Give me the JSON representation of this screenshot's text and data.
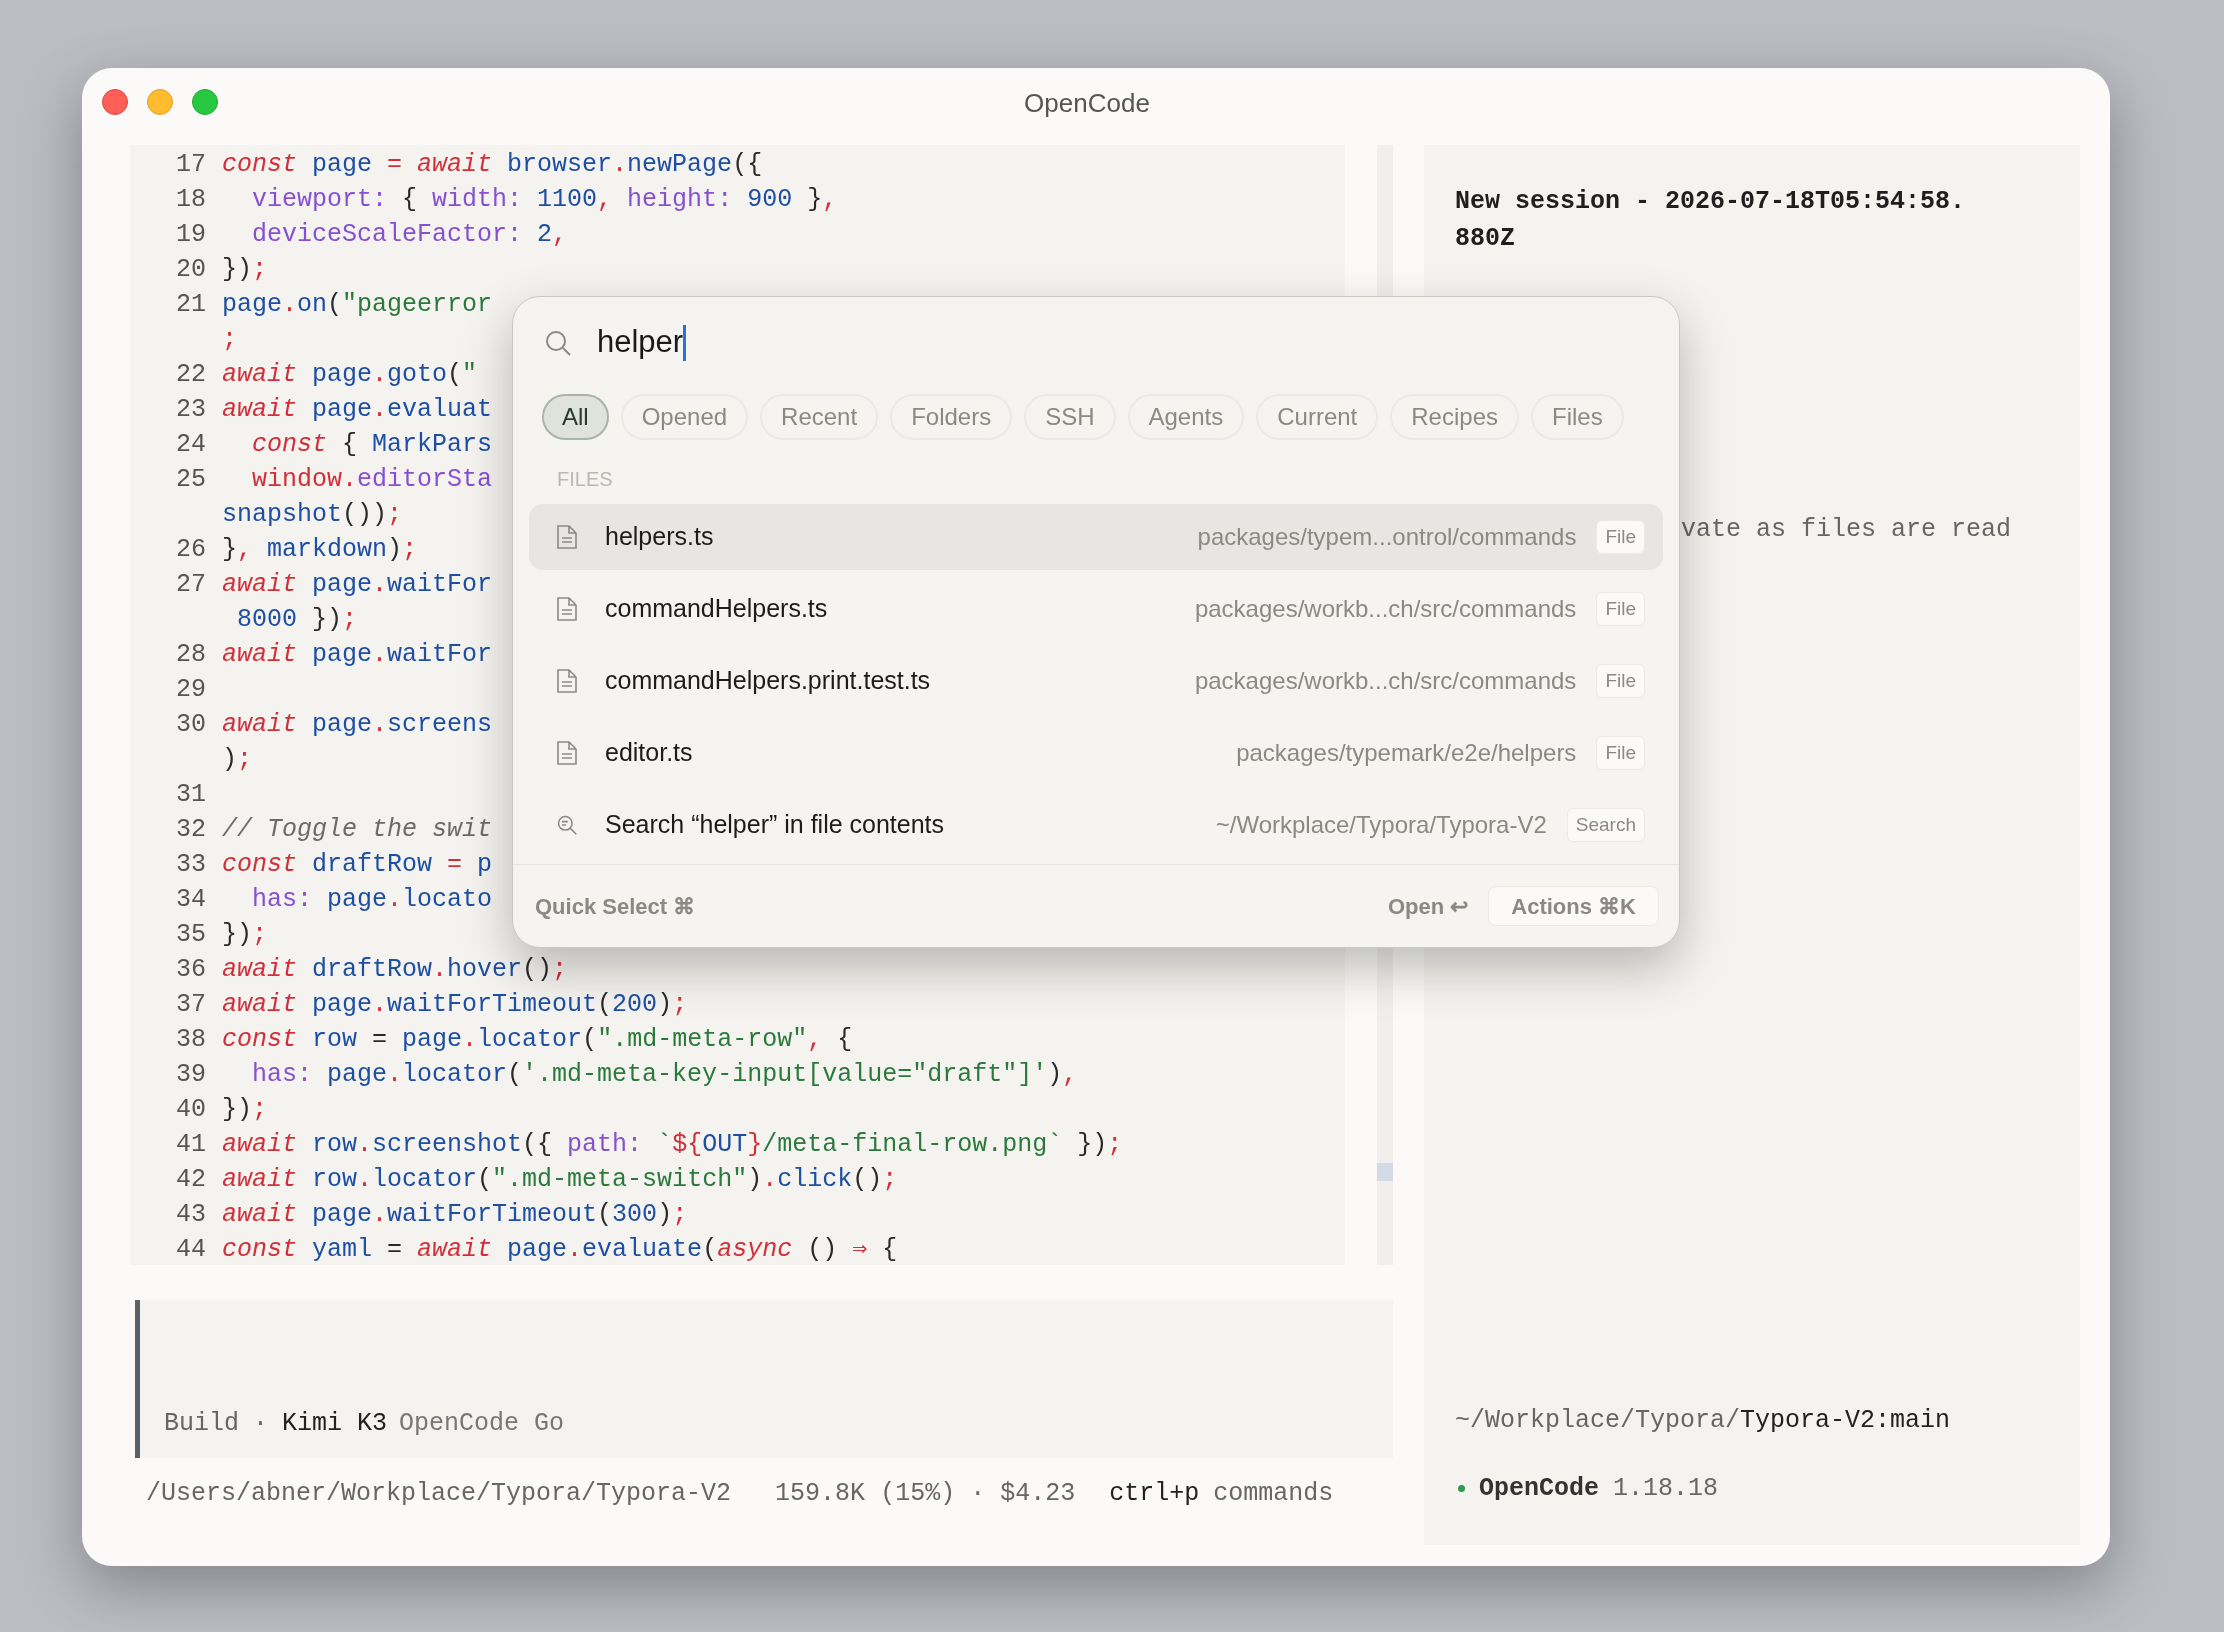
{
  "window": {
    "title": "OpenCode"
  },
  "editor": {
    "lines": [
      {
        "num": "17",
        "tokens": [
          {
            "kind": "kw",
            "text": "const"
          },
          {
            "kind": "id",
            "text": " page"
          },
          {
            "kind": "pu",
            "text": " ="
          },
          {
            "kind": "kw",
            "text": " await"
          },
          {
            "kind": "id",
            "text": " browser"
          },
          {
            "kind": "pu",
            "text": "."
          },
          {
            "kind": "id",
            "text": "newPage"
          },
          {
            "kind": "pl",
            "text": "({"
          }
        ]
      },
      {
        "num": "18",
        "tokens": [
          {
            "kind": "pr",
            "text": "  viewport:"
          },
          {
            "kind": "pl",
            "text": " {"
          },
          {
            "kind": "pr",
            "text": " width:"
          },
          {
            "kind": "nu",
            "text": " 1100"
          },
          {
            "kind": "pu",
            "text": ","
          },
          {
            "kind": "pr",
            "text": " height:"
          },
          {
            "kind": "nu",
            "text": " 900"
          },
          {
            "kind": "pl",
            "text": " }"
          },
          {
            "kind": "pu",
            "text": ","
          }
        ]
      },
      {
        "num": "19",
        "tokens": [
          {
            "kind": "pr",
            "text": "  deviceScaleFactor:"
          },
          {
            "kind": "nu",
            "text": " 2"
          },
          {
            "kind": "pu",
            "text": ","
          }
        ]
      },
      {
        "num": "20",
        "tokens": [
          {
            "kind": "pl",
            "text": "})"
          },
          {
            "kind": "pu",
            "text": ";"
          }
        ]
      },
      {
        "num": "21",
        "tokens": [
          {
            "kind": "id",
            "text": "page"
          },
          {
            "kind": "pu",
            "text": "."
          },
          {
            "kind": "id",
            "text": "on"
          },
          {
            "kind": "pl",
            "text": "("
          },
          {
            "kind": "st",
            "text": "\"pageerror"
          }
        ],
        "continuation": [
          {
            "kind": "pu",
            "text": ";"
          }
        ]
      },
      {
        "num": "22",
        "tokens": [
          {
            "kind": "kw",
            "text": "await"
          },
          {
            "kind": "id",
            "text": " page"
          },
          {
            "kind": "pu",
            "text": "."
          },
          {
            "kind": "id",
            "text": "goto"
          },
          {
            "kind": "pl",
            "text": "("
          },
          {
            "kind": "st",
            "text": "\""
          }
        ]
      },
      {
        "num": "23",
        "tokens": [
          {
            "kind": "kw",
            "text": "await"
          },
          {
            "kind": "id",
            "text": " page"
          },
          {
            "kind": "pu",
            "text": "."
          },
          {
            "kind": "id",
            "text": "evaluat"
          }
        ]
      },
      {
        "num": "24",
        "tokens": [
          {
            "kind": "kw",
            "text": "  const"
          },
          {
            "kind": "pl",
            "text": " {"
          },
          {
            "kind": "id",
            "text": " MarkPars"
          }
        ]
      },
      {
        "num": "25",
        "tokens": [
          {
            "kind": "va",
            "text": "  window"
          },
          {
            "kind": "pu",
            "text": "."
          },
          {
            "kind": "pr",
            "text": "editorSta"
          }
        ],
        "continuation": [
          {
            "kind": "id",
            "text": "snapshot"
          },
          {
            "kind": "pl",
            "text": "())"
          },
          {
            "kind": "pu",
            "text": ";"
          }
        ]
      },
      {
        "num": "26",
        "tokens": [
          {
            "kind": "pl",
            "text": "}"
          },
          {
            "kind": "pu",
            "text": ","
          },
          {
            "kind": "id",
            "text": " markdown"
          },
          {
            "kind": "pl",
            "text": ")"
          },
          {
            "kind": "pu",
            "text": ";"
          }
        ]
      },
      {
        "num": "27",
        "tokens": [
          {
            "kind": "kw",
            "text": "await"
          },
          {
            "kind": "id",
            "text": " page"
          },
          {
            "kind": "pu",
            "text": "."
          },
          {
            "kind": "id",
            "text": "waitFor"
          }
        ],
        "continuation": [
          {
            "kind": "nu",
            "text": " 8000"
          },
          {
            "kind": "pl",
            "text": " })"
          },
          {
            "kind": "pu",
            "text": ";"
          }
        ]
      },
      {
        "num": "28",
        "tokens": [
          {
            "kind": "kw",
            "text": "await"
          },
          {
            "kind": "id",
            "text": " page"
          },
          {
            "kind": "pu",
            "text": "."
          },
          {
            "kind": "id",
            "text": "waitFor"
          }
        ]
      },
      {
        "num": "29"
      },
      {
        "num": "30",
        "tokens": [
          {
            "kind": "kw",
            "text": "await"
          },
          {
            "kind": "id",
            "text": " page"
          },
          {
            "kind": "pu",
            "text": "."
          },
          {
            "kind": "id",
            "text": "screens"
          }
        ],
        "continuation": [
          {
            "kind": "pl",
            "text": ")"
          },
          {
            "kind": "pu",
            "text": ";"
          }
        ]
      },
      {
        "num": "31"
      },
      {
        "num": "32",
        "tokens": [
          {
            "kind": "co",
            "text": "// Toggle the swit"
          }
        ]
      },
      {
        "num": "33",
        "tokens": [
          {
            "kind": "kw",
            "text": "const"
          },
          {
            "kind": "id",
            "text": " draftRow"
          },
          {
            "kind": "pu",
            "text": " ="
          },
          {
            "kind": "id",
            "text": " p"
          }
        ]
      },
      {
        "num": "34",
        "tokens": [
          {
            "kind": "pr",
            "text": "  has:"
          },
          {
            "kind": "id",
            "text": " page"
          },
          {
            "kind": "pu",
            "text": "."
          },
          {
            "kind": "id",
            "text": "locato"
          }
        ]
      },
      {
        "num": "35",
        "tokens": [
          {
            "kind": "pl",
            "text": "})"
          },
          {
            "kind": "pu",
            "text": ";"
          }
        ]
      },
      {
        "num": "36",
        "tokens": [
          {
            "kind": "kw",
            "text": "await"
          },
          {
            "kind": "id",
            "text": " draftRow"
          },
          {
            "kind": "pu",
            "text": "."
          },
          {
            "kind": "id",
            "text": "hover"
          },
          {
            "kind": "pl",
            "text": "()"
          },
          {
            "kind": "pu",
            "text": ";"
          }
        ]
      },
      {
        "num": "37",
        "tokens": [
          {
            "kind": "kw",
            "text": "await"
          },
          {
            "kind": "id",
            "text": " page"
          },
          {
            "kind": "pu",
            "text": "."
          },
          {
            "kind": "id",
            "text": "waitForTimeout"
          },
          {
            "kind": "pl",
            "text": "("
          },
          {
            "kind": "nu",
            "text": "200"
          },
          {
            "kind": "pl",
            "text": ")"
          },
          {
            "kind": "pu",
            "text": ";"
          }
        ]
      },
      {
        "num": "38",
        "tokens": [
          {
            "kind": "kw",
            "text": "const"
          },
          {
            "kind": "id",
            "text": " row"
          },
          {
            "kind": "pl",
            "text": " ="
          },
          {
            "kind": "id",
            "text": " page"
          },
          {
            "kind": "pu",
            "text": "."
          },
          {
            "kind": "id",
            "text": "locator"
          },
          {
            "kind": "pl",
            "text": "("
          },
          {
            "kind": "st",
            "text": "\".md-meta-row\""
          },
          {
            "kind": "pu",
            "text": ","
          },
          {
            "kind": "pl",
            "text": " {"
          }
        ]
      },
      {
        "num": "39",
        "tokens": [
          {
            "kind": "pr",
            "text": "  has:"
          },
          {
            "kind": "id",
            "text": " page"
          },
          {
            "kind": "pu",
            "text": "."
          },
          {
            "kind": "id",
            "text": "locator"
          },
          {
            "kind": "pl",
            "text": "("
          },
          {
            "kind": "st",
            "text": "'.md-meta-key-input[value=\"draft\"]'"
          },
          {
            "kind": "pl",
            "text": ")"
          },
          {
            "kind": "pu",
            "text": ","
          }
        ]
      },
      {
        "num": "40",
        "tokens": [
          {
            "kind": "pl",
            "text": "})"
          },
          {
            "kind": "pu",
            "text": ";"
          }
        ]
      },
      {
        "num": "41",
        "tokens": [
          {
            "kind": "kw",
            "text": "await"
          },
          {
            "kind": "id",
            "text": " row"
          },
          {
            "kind": "pu",
            "text": "."
          },
          {
            "kind": "id",
            "text": "screenshot"
          },
          {
            "kind": "pl",
            "text": "({"
          },
          {
            "kind": "pr",
            "text": " path:"
          },
          {
            "kind": "st",
            "text": " `"
          },
          {
            "kind": "va",
            "text": "${"
          },
          {
            "kind": "id",
            "text": "OUT"
          },
          {
            "kind": "va",
            "text": "}"
          },
          {
            "kind": "st",
            "text": "/meta-final-row.png`"
          },
          {
            "kind": "pl",
            "text": " })"
          },
          {
            "kind": "pu",
            "text": ";"
          }
        ]
      },
      {
        "num": "42",
        "tokens": [
          {
            "kind": "kw",
            "text": "await"
          },
          {
            "kind": "id",
            "text": " row"
          },
          {
            "kind": "pu",
            "text": "."
          },
          {
            "kind": "id",
            "text": "locator"
          },
          {
            "kind": "pl",
            "text": "("
          },
          {
            "kind": "st",
            "text": "\".md-meta-switch\""
          },
          {
            "kind": "pl",
            "text": ")"
          },
          {
            "kind": "pu",
            "text": "."
          },
          {
            "kind": "id",
            "text": "click"
          },
          {
            "kind": "pl",
            "text": "()"
          },
          {
            "kind": "pu",
            "text": ";"
          }
        ]
      },
      {
        "num": "43",
        "tokens": [
          {
            "kind": "kw",
            "text": "await"
          },
          {
            "kind": "id",
            "text": " page"
          },
          {
            "kind": "pu",
            "text": "."
          },
          {
            "kind": "id",
            "text": "waitForTimeout"
          },
          {
            "kind": "pl",
            "text": "("
          },
          {
            "kind": "nu",
            "text": "300"
          },
          {
            "kind": "pl",
            "text": ")"
          },
          {
            "kind": "pu",
            "text": ";"
          }
        ]
      },
      {
        "num": "44",
        "tokens": [
          {
            "kind": "kw",
            "text": "const"
          },
          {
            "kind": "id",
            "text": " yaml"
          },
          {
            "kind": "pl",
            "text": " ="
          },
          {
            "kind": "kw",
            "text": " await"
          },
          {
            "kind": "id",
            "text": " page"
          },
          {
            "kind": "pu",
            "text": "."
          },
          {
            "kind": "id",
            "text": "evaluate"
          },
          {
            "kind": "pl",
            "text": "("
          },
          {
            "kind": "kw",
            "text": "async"
          },
          {
            "kind": "pl",
            "text": " ()"
          },
          {
            "kind": "va",
            "text": " ⇒"
          },
          {
            "kind": "pl",
            "text": " {"
          }
        ]
      }
    ]
  },
  "prompt": {
    "mode": "Build",
    "separator": "·",
    "model": "Kimi K3",
    "provider": "OpenCode Go"
  },
  "status_bar": {
    "path": "/Users/abner/Workplace/Typora/Typora-V2",
    "usage": "159.8K (15%) · $4.23",
    "shortcut": "ctrl+p",
    "shortcut_label": "commands"
  },
  "session": {
    "title": "New session - 2026-07-18T05:54:58.880Z",
    "note": "vate as files are read",
    "cwd_prefix": "~/Workplace/Typora/",
    "cwd_branch": "Typora-V2:main",
    "app_name": "OpenCode",
    "version": "1.18.18"
  },
  "palette": {
    "query": "helper",
    "filters": [
      {
        "label": "All",
        "selected": true
      },
      {
        "label": "Opened",
        "selected": false
      },
      {
        "label": "Recent",
        "selected": false
      },
      {
        "label": "Folders",
        "selected": false
      },
      {
        "label": "SSH",
        "selected": false
      },
      {
        "label": "Agents",
        "selected": false
      },
      {
        "label": "Current",
        "selected": false
      },
      {
        "label": "Recipes",
        "selected": false
      },
      {
        "label": "Files",
        "selected": false
      }
    ],
    "section": "FILES",
    "results": [
      {
        "kind": "file",
        "name": "helpers.ts",
        "path": "packages/typem...ontrol/commands",
        "badge": "File",
        "selected": true
      },
      {
        "kind": "file",
        "name": "commandHelpers.ts",
        "path": "packages/workb...ch/src/commands",
        "badge": "File",
        "selected": false
      },
      {
        "kind": "file",
        "name": "commandHelpers.print.test.ts",
        "path": "packages/workb...ch/src/commands",
        "badge": "File",
        "selected": false
      },
      {
        "kind": "file",
        "name": "editor.ts",
        "path": "packages/typemark/e2e/helpers",
        "badge": "File",
        "selected": false
      },
      {
        "kind": "search",
        "name": "Search “helper” in file contents",
        "path": "~/Workplace/Typora/Typora-V2",
        "badge": "Search",
        "selected": false
      }
    ],
    "footer": {
      "quick_select": "Quick Select ⌘",
      "open": "Open ↩",
      "actions": "Actions ⌘K"
    }
  }
}
